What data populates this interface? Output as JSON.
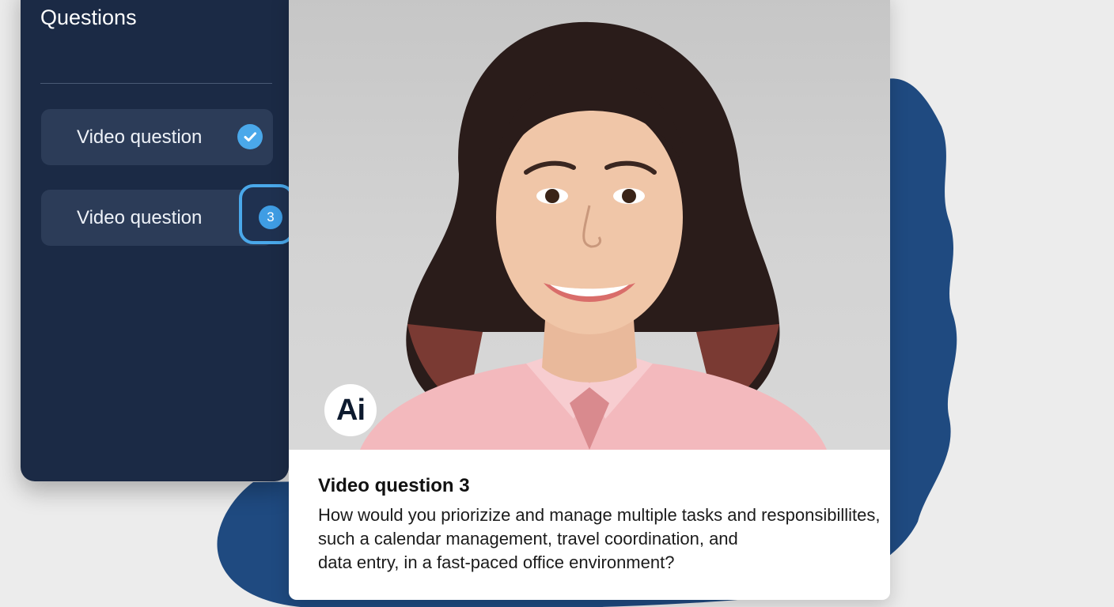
{
  "sidebar": {
    "title": "Questions",
    "items": [
      {
        "label": "Video question",
        "status": "completed",
        "icon": "check-icon"
      },
      {
        "label": "Video question",
        "number": "3",
        "status": "current"
      }
    ]
  },
  "video": {
    "ai_badge": "Ai"
  },
  "question": {
    "title": "Video question 3",
    "lines": [
      "How would you priorizize and manage multiple tasks and responsibillites,",
      "such a calendar management, travel coordination, and",
      "data entry, in a fast-paced office environment?"
    ]
  },
  "colors": {
    "sidebar_bg": "#1b2a45",
    "item_bg": "#2c3c58",
    "accent": "#4aa8ea",
    "backdrop_blob": "#1f4a80",
    "page_bg": "#ececec"
  }
}
